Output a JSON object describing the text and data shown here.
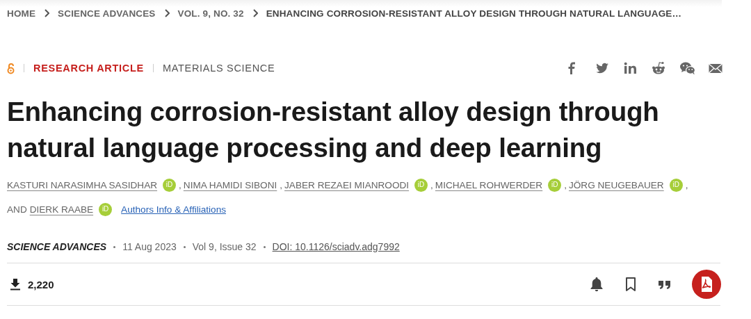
{
  "breadcrumb": [
    "HOME",
    "SCIENCE ADVANCES",
    "VOL. 9, NO. 32",
    "ENHANCING CORROSION-RESISTANT ALLOY DESIGN THROUGH NATURAL LANGUAGE…"
  ],
  "article_type": "RESEARCH ARTICLE",
  "subject": "MATERIALS SCIENCE",
  "title": "Enhancing corrosion-resistant alloy design through natural language processing and deep learning",
  "authors": [
    {
      "name": "KASTURI NARASIMHA SASIDHAR",
      "orcid": "iD",
      "after": ","
    },
    {
      "name": "NIMA HAMIDI SIBONI",
      "after": ","
    },
    {
      "name": "JABER REZAEI MIANROODI",
      "orcid": "iD",
      "after": ","
    },
    {
      "name": "MICHAEL ROHWERDER",
      "orcid": "iD",
      "after": ","
    },
    {
      "name": "JÖRG NEUGEBAUER",
      "orcid": "iD",
      "after": ","
    },
    {
      "before": "AND",
      "name": "DIERK RAABE",
      "orcid": "iD"
    }
  ],
  "affiliations_link": "Authors Info & Affiliations",
  "journal": "SCIENCE ADVANCES",
  "date": "11 Aug 2023",
  "issue": "Vol 9, Issue 32",
  "doi": "DOI: 10.1126/sciadv.adg7992",
  "downloads": "2,220"
}
